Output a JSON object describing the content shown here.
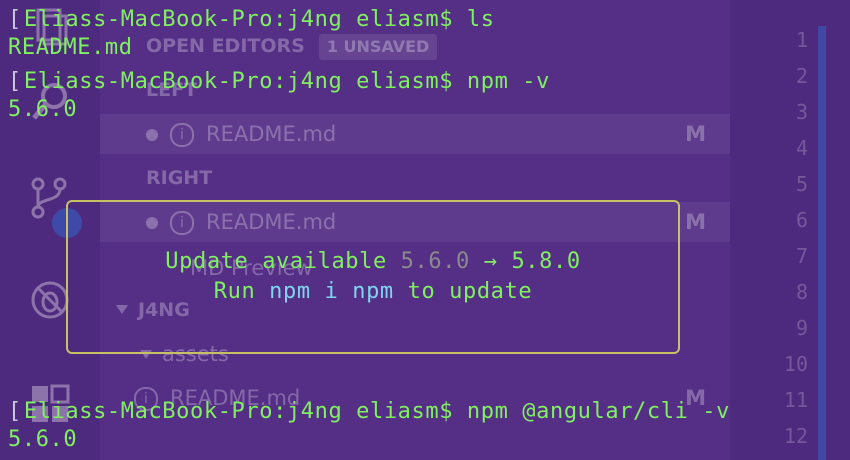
{
  "terminal": {
    "prompt": "Eliass-MacBook-Pro:j4ng eliasm$ ",
    "lines": [
      {
        "command": "ls",
        "output": "README.md"
      },
      {
        "command": "npm -v",
        "output": "5.6.0"
      },
      {
        "command": "npm @angular/cli -v",
        "output": "5.6.0"
      }
    ]
  },
  "update_notice": {
    "prefix": "Update available ",
    "current_version": "5.6.0",
    "arrow": " → ",
    "new_version": "5.8.0",
    "run": "Run ",
    "command": "npm i npm",
    "suffix": " to update"
  },
  "editor": {
    "open_editors_label": "OPEN EDITORS",
    "unsaved_badge": "1 UNSAVED",
    "left_group": "LEFT",
    "right_group": "RIGHT",
    "file_left": "README.md",
    "file_right": "README.md",
    "preview_label": "MD Preview",
    "folder_label": "J4NG",
    "subfolder_label": "assets",
    "file_bottom": "README.md",
    "modified_marker": "M",
    "line_numbers": [
      "1",
      "2",
      "3",
      "4",
      "5",
      "6",
      "7",
      "8",
      "9",
      "10",
      "11",
      "12"
    ]
  },
  "colors": {
    "background": "#4e2a7e",
    "terminal_text": "#7ff060",
    "box_border": "#c8c164",
    "highlight": "#7fd3ee"
  },
  "icons": [
    "files-icon",
    "search-icon",
    "source-control-icon",
    "debug-icon",
    "extensions-icon"
  ]
}
